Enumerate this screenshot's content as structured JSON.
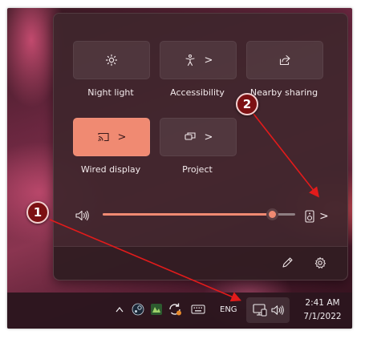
{
  "quick_settings": {
    "tiles": [
      {
        "label": "Night light",
        "icon": "sun-icon",
        "expandable": false,
        "active": false
      },
      {
        "label": "Accessibility",
        "icon": "accessibility-icon",
        "expandable": true,
        "active": false
      },
      {
        "label": "Nearby sharing",
        "icon": "share-icon",
        "expandable": false,
        "active": false
      },
      {
        "label": "Wired display",
        "icon": "cast-icon",
        "expandable": true,
        "active": true
      },
      {
        "label": "Project",
        "icon": "project-icon",
        "expandable": true,
        "active": false
      }
    ],
    "chevron": ">",
    "volume": {
      "level": 0.88,
      "icon": "speaker-icon",
      "output_icon": "audio-output-icon"
    },
    "footer": {
      "edit_icon": "pencil-icon",
      "settings_icon": "gear-icon"
    }
  },
  "taskbar": {
    "tray_icons": [
      "chevron-up-icon",
      "steam-icon",
      "app-icon",
      "sync-icon",
      "keyboard-icon"
    ],
    "language": "ENG",
    "time": "2:41 AM",
    "date": "7/1/2022"
  },
  "annotations": {
    "marker_1": "1",
    "marker_2": "2",
    "accent": "#f08a72",
    "marker_color": "#7c1113"
  }
}
